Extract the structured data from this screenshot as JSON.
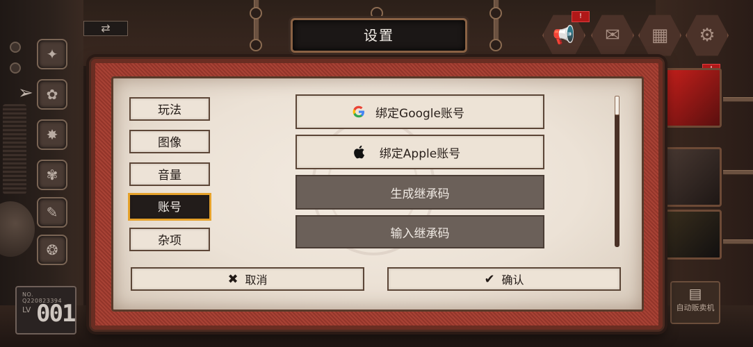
{
  "title": "设置",
  "tabs": [
    {
      "label": "玩法",
      "active": false
    },
    {
      "label": "图像",
      "active": false
    },
    {
      "label": "音量",
      "active": false
    },
    {
      "label": "账号",
      "active": true
    },
    {
      "label": "杂项",
      "active": false
    }
  ],
  "account_options": [
    {
      "label": "绑定Google账号",
      "icon": "google-icon",
      "style": "light"
    },
    {
      "label": "绑定Apple账号",
      "icon": "apple-icon",
      "style": "light"
    },
    {
      "label": "生成继承码",
      "icon": "",
      "style": "dark"
    },
    {
      "label": "输入继承码",
      "icon": "",
      "style": "dark"
    }
  ],
  "footer": {
    "cancel_label": "取消",
    "cancel_icon": "close-icon",
    "confirm_label": "确认",
    "confirm_icon": "checkmark-icon"
  },
  "player": {
    "no_text": "NO. Q220823394",
    "lv_label": "LV",
    "level": "001"
  },
  "vending": {
    "label": "自动贩卖机"
  },
  "notifications": [
    "!",
    "!"
  ],
  "colors": {
    "active_tab_border": "#e6a22b",
    "frame_red": "#9e3a2e",
    "panel_bg": "#ece2d6",
    "dark_option_bg": "#6b6059"
  }
}
